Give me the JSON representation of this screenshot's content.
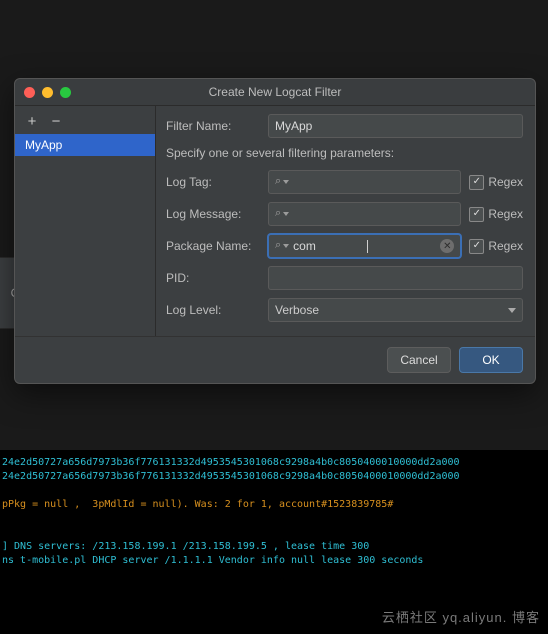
{
  "dialog": {
    "title": "Create New Logcat Filter",
    "sidebar": {
      "items": [
        {
          "label": "MyApp",
          "selected": true
        }
      ]
    },
    "form": {
      "filter_name": {
        "label": "Filter Name:",
        "value": "MyApp"
      },
      "description": "Specify one or several filtering parameters:",
      "log_tag": {
        "label": "Log Tag:",
        "value": "",
        "regex_label": "Regex",
        "regex_checked": true
      },
      "log_message": {
        "label": "Log Message:",
        "value": "",
        "regex_label": "Regex",
        "regex_checked": true
      },
      "package_name": {
        "label": "Package Name:",
        "value": "com",
        "regex_label": "Regex",
        "regex_checked": true,
        "focused": true
      },
      "pid": {
        "label": "PID:",
        "value": ""
      },
      "log_level": {
        "label": "Log Level:",
        "value": "Verbose"
      }
    },
    "buttons": {
      "cancel": "Cancel",
      "ok": "OK"
    }
  },
  "bg": {
    "tab_letter": "C"
  },
  "console": {
    "lines": [
      {
        "cls": "cl-cyan",
        "text": "24e2d50727a656d7973b36f776131332d4953545301068c9298a4b0c8050400010000dd2a000"
      },
      {
        "cls": "cl-cyan",
        "text": "24e2d50727a656d7973b36f776131332d4953545301068c9298a4b0c8050400010000dd2a000"
      },
      {
        "cls": "",
        "text": ""
      },
      {
        "cls": "cl-orange",
        "text": "pPkg = null ,  3pMdlId = null). Was: 2 for 1, account#1523839785#"
      },
      {
        "cls": "",
        "text": ""
      },
      {
        "cls": "",
        "text": ""
      },
      {
        "cls": "cl-cyan",
        "text": "] DNS servers: /213.158.199.1 /213.158.199.5 , lease time 300"
      },
      {
        "cls": "cl-cyan",
        "text": "ns t-mobile.pl DHCP server /1.1.1.1 Vendor info null lease 300 seconds"
      }
    ]
  },
  "watermark": "云栖社区 yq.aliyun. 博客"
}
